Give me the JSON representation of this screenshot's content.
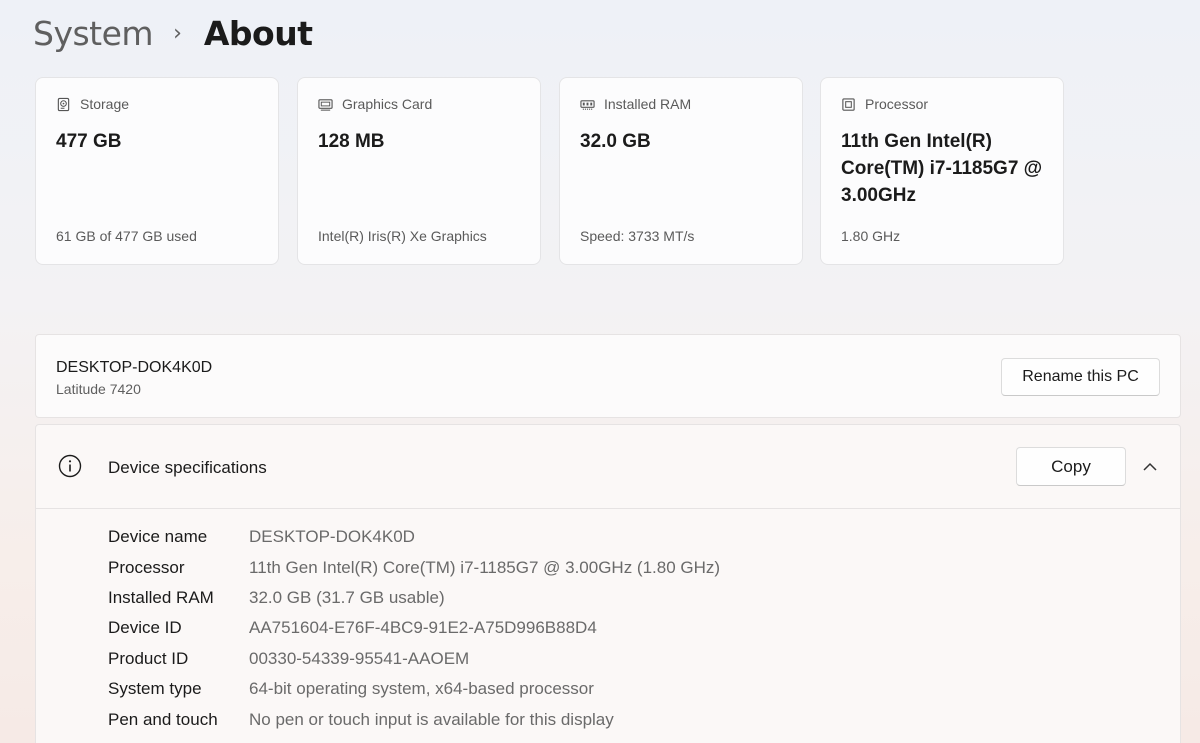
{
  "breadcrumb": {
    "parent": "System",
    "separator": "›",
    "current": "About"
  },
  "cards": [
    {
      "icon": "storage-icon",
      "label": "Storage",
      "value": "477 GB",
      "sub": "61 GB of 477 GB used"
    },
    {
      "icon": "graphics-card-icon",
      "label": "Graphics Card",
      "value": "128 MB",
      "sub": "Intel(R) Iris(R) Xe Graphics"
    },
    {
      "icon": "ram-icon",
      "label": "Installed RAM",
      "value": "32.0 GB",
      "sub": "Speed: 3733 MT/s"
    },
    {
      "icon": "processor-icon",
      "label": "Processor",
      "value": "11th Gen Intel(R) Core(TM) i7-1185G7 @ 3.00GHz",
      "sub": "1.80 GHz"
    }
  ],
  "pc": {
    "name": "DESKTOP-DOK4K0D",
    "model": "Latitude 7420",
    "rename_label": "Rename this PC"
  },
  "specs": {
    "title": "Device specifications",
    "copy_label": "Copy",
    "rows": [
      {
        "label": "Device name",
        "value": "DESKTOP-DOK4K0D"
      },
      {
        "label": "Processor",
        "value": "11th Gen Intel(R) Core(TM) i7-1185G7 @ 3.00GHz (1.80 GHz)"
      },
      {
        "label": "Installed RAM",
        "value": "32.0 GB (31.7 GB usable)"
      },
      {
        "label": "Device ID",
        "value": "AA751604-E76F-4BC9-91E2-A75D996B88D4"
      },
      {
        "label": "Product ID",
        "value": "00330-54339-95541-AAOEM"
      },
      {
        "label": "System type",
        "value": "64-bit operating system, x64-based processor"
      },
      {
        "label": "Pen and touch",
        "value": "No pen or touch input is available for this display"
      }
    ]
  }
}
